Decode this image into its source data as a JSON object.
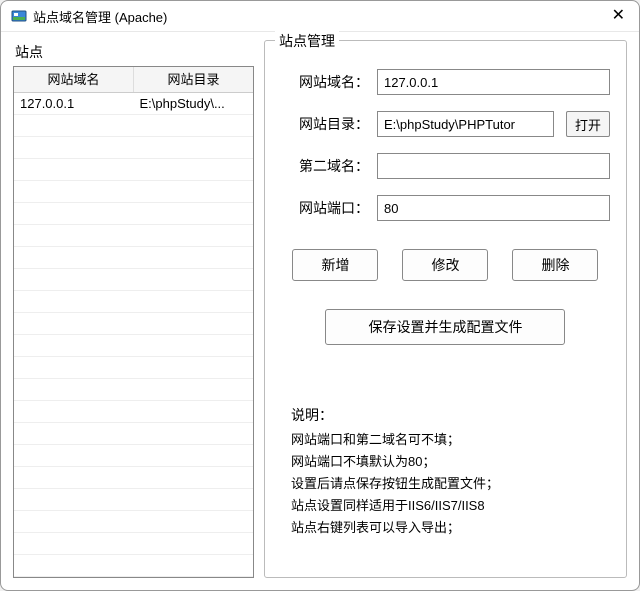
{
  "window": {
    "title": "站点域名管理 (Apache)"
  },
  "left": {
    "label": "站点",
    "columns": [
      "网站域名",
      "网站目录"
    ],
    "rows": [
      {
        "domain": "127.0.0.1",
        "dir": "E:\\phpStudy\\..."
      }
    ],
    "blank_rows": 21
  },
  "right": {
    "legend": "站点管理",
    "fields": {
      "domain_label": "网站域名：",
      "domain_value": "127.0.0.1",
      "dir_label": "网站目录：",
      "dir_value": "E:\\phpStudy\\PHPTutor",
      "open_label": "打开",
      "second_domain_label": "第二域名：",
      "second_domain_value": "",
      "port_label": "网站端口：",
      "port_value": "80"
    },
    "actions": {
      "add": "新增",
      "modify": "修改",
      "delete": "删除",
      "save": "保存设置并生成配置文件"
    }
  },
  "description": {
    "title": "说明：",
    "lines": [
      "网站端口和第二域名可不填；",
      "网站端口不填默认为80；",
      "设置后请点保存按钮生成配置文件；",
      "站点设置同样适用于IIS6/IIS7/IIS8",
      "站点右键列表可以导入导出；"
    ]
  }
}
